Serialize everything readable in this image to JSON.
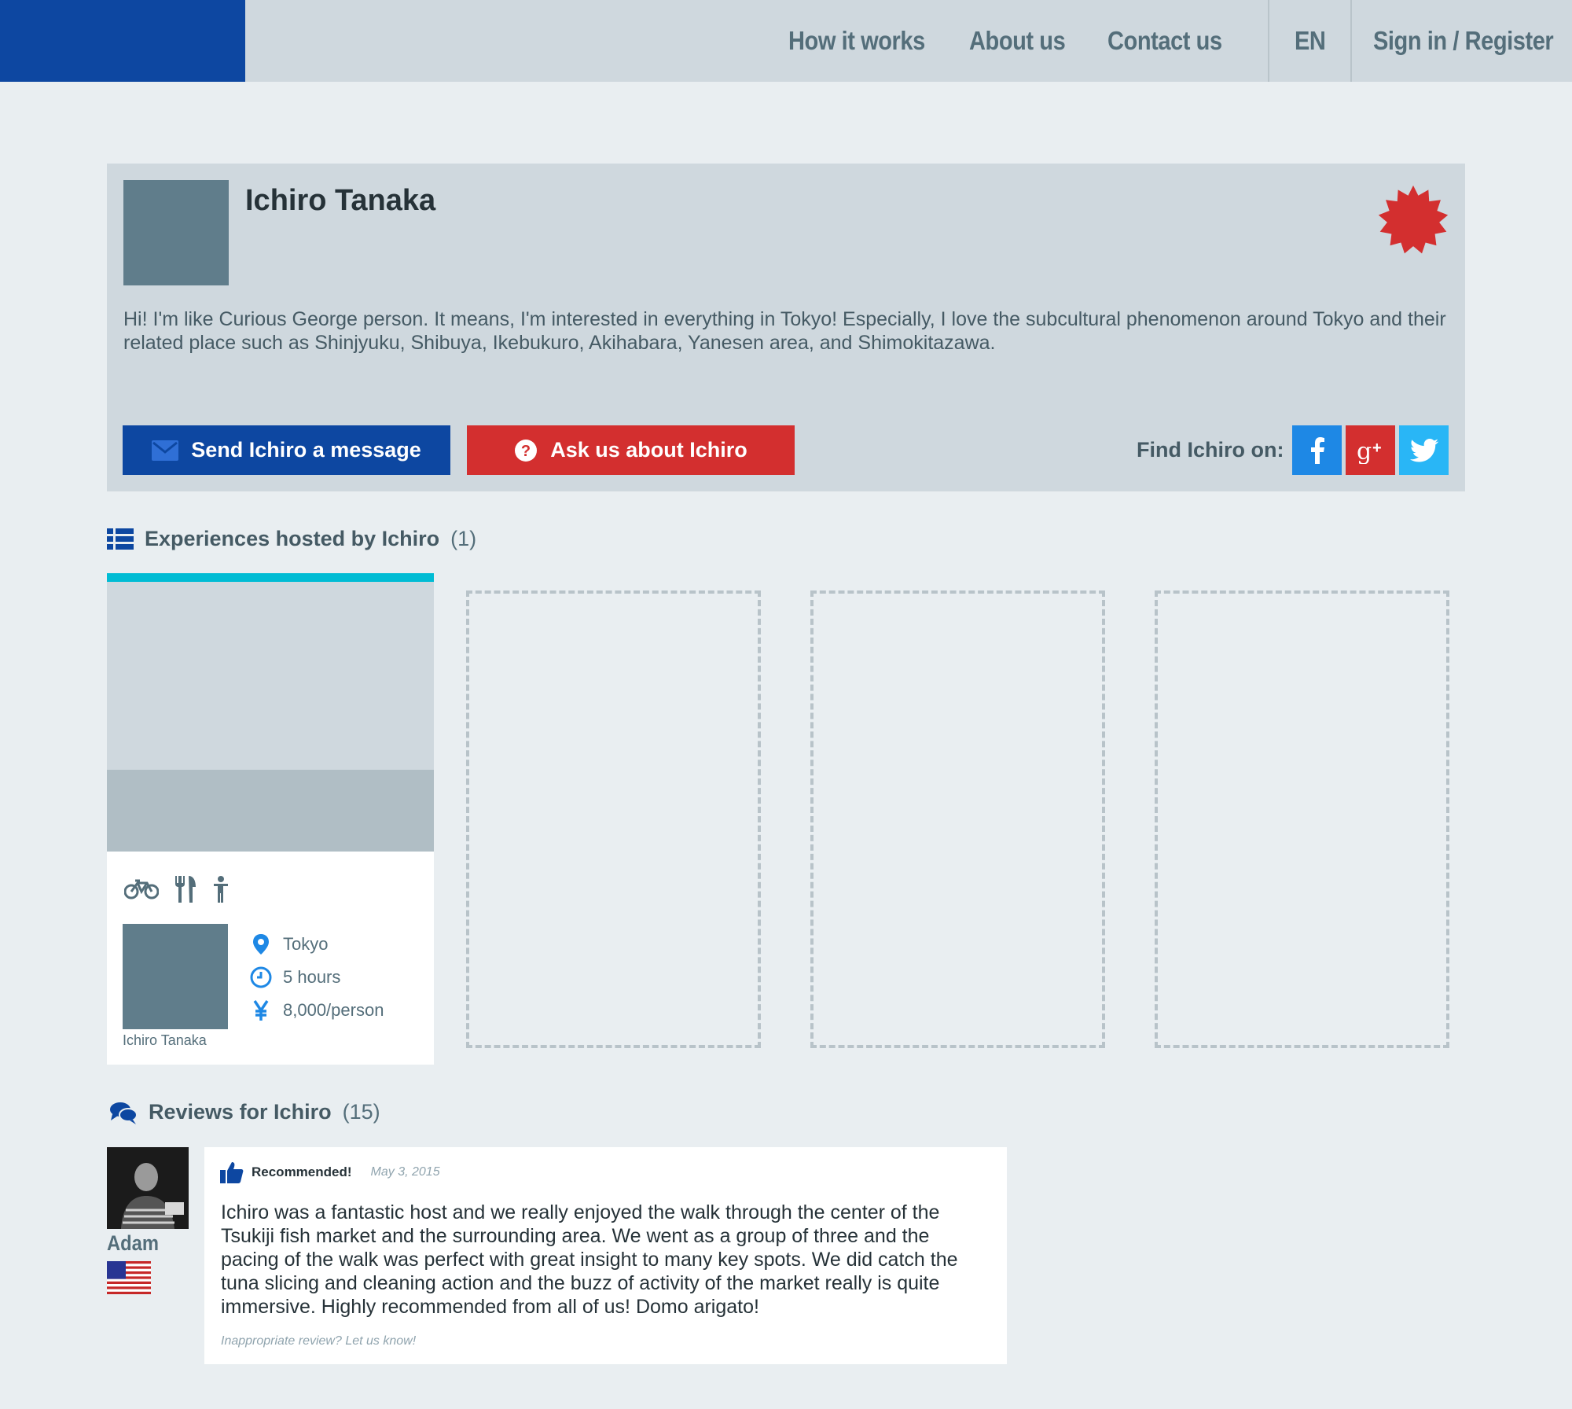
{
  "nav": {
    "links": [
      "How it works",
      "About us",
      "Contact us"
    ],
    "language": "EN",
    "auth": "Sign in / Register"
  },
  "profile": {
    "name": "Ichiro Tanaka",
    "bio": "Hi! I'm like Curious George person. It means, I'm interested in everything in Tokyo! Especially, I love the subcultural phenomenon around Tokyo and their related place such as Shinjyuku, Shibuya, Ikebukuro, Akihabara, Yanesen area, and Shimokitazawa.",
    "message_button": "Send Ichiro a message",
    "ask_button": "Ask us about Ichiro",
    "find_label": "Find Ichiro on:",
    "social_icons": [
      "facebook-icon",
      "google-plus-icon",
      "twitter-icon"
    ]
  },
  "experiences": {
    "heading": "Experiences hosted by Ichiro",
    "count": "(1)",
    "card": {
      "activity_icons": [
        "bicycle-icon",
        "fork-knife-icon",
        "person-icon"
      ],
      "host_name": "Ichiro Tanaka",
      "location": "Tokyo",
      "duration": "5 hours",
      "price": "8,000/person"
    }
  },
  "reviews": {
    "heading": "Reviews for Ichiro",
    "count": "(15)",
    "items": [
      {
        "reviewer": "Adam",
        "flag": "us-flag-icon",
        "recommended_label": "Recommended!",
        "date": "May 3, 2015",
        "text": "Ichiro was a fantastic host and we really enjoyed the walk through the center of the Tsukiji fish market and the surrounding area. We went as a group of three and the pacing of the walk was perfect with great insight to many key spots. We did catch the tuna slicing and cleaning action and the buzz of activity of the market really is quite immersive. Highly recommended from all of us! Domo arigato!",
        "report_link": "Inappropriate review? Let us know!"
      }
    ]
  },
  "colors": {
    "brand_blue": "#0d47a1",
    "accent_red": "#d32f2f",
    "accent_cyan": "#00bcd4",
    "facebook": "#1e88e5",
    "twitter": "#29b6f6"
  }
}
